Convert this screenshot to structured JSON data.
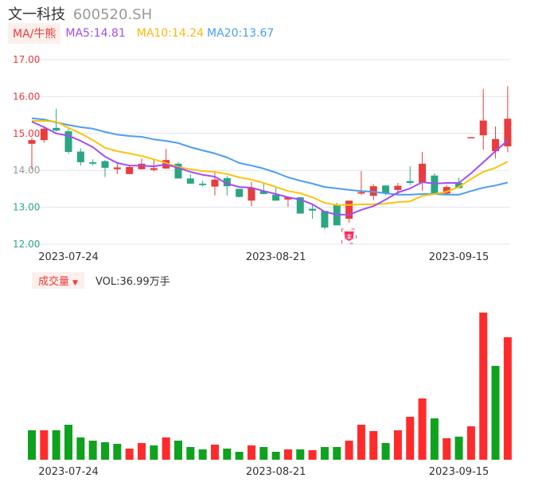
{
  "header": {
    "name": "文一科技",
    "code": "600520.SH"
  },
  "legend": {
    "tag": "MA/牛熊",
    "ma5": "MA5:14.81",
    "ma10": "MA10:14.24",
    "ma20": "MA20:13.67"
  },
  "volume_legend": {
    "tag": "成交量",
    "arrow": "▼",
    "value": "VOL:36.99万手"
  },
  "colors": {
    "up": "#ea3c3c",
    "down": "#2aa683",
    "vol_up": "#ff2b2b",
    "vol_down": "#0fa21e",
    "ma5": "#a34cf5",
    "ma10": "#fdc30d",
    "ma20": "#4b9ef0",
    "grid": "#e1e5f0"
  },
  "chart_data": [
    {
      "type": "candlestick",
      "title": "文一科技 600520.SH",
      "ylim": [
        12,
        17
      ],
      "y_ticks": [
        {
          "label": "17.00",
          "value": 17,
          "color": "#f0393c"
        },
        {
          "label": "16.00",
          "value": 16,
          "color": "#f0393c"
        },
        {
          "label": "15.00",
          "value": 15,
          "color": "#f0393c"
        },
        {
          "label": "14.00",
          "value": 14,
          "color": "#999999"
        },
        {
          "label": "13.00",
          "value": 13,
          "color": "#2aa683"
        },
        {
          "label": "12.00",
          "value": 12,
          "color": "#2aa683"
        }
      ],
      "x_ticks": [
        {
          "label": "2023-07-24",
          "index": 3
        },
        {
          "label": "2023-08-21",
          "index": 20
        },
        {
          "label": "2023-09-15",
          "index": 35
        }
      ],
      "ohlc": [
        [
          14.72,
          14.88,
          14.03,
          14.82
        ],
        [
          14.82,
          15.2,
          14.75,
          15.13
        ],
        [
          15.15,
          15.67,
          15.05,
          15.08
        ],
        [
          15.06,
          15.13,
          14.45,
          14.5
        ],
        [
          14.51,
          14.6,
          14.13,
          14.22
        ],
        [
          14.22,
          14.3,
          14.13,
          14.18
        ],
        [
          14.25,
          14.28,
          13.82,
          14.07
        ],
        [
          14.03,
          14.2,
          13.9,
          14.08
        ],
        [
          13.9,
          14.12,
          13.9,
          14.09
        ],
        [
          14.03,
          14.32,
          14.03,
          14.18
        ],
        [
          14.01,
          14.28,
          13.97,
          14.06
        ],
        [
          14.05,
          14.58,
          14.05,
          14.28
        ],
        [
          14.18,
          14.22,
          13.78,
          13.78
        ],
        [
          13.78,
          13.9,
          13.64,
          13.64
        ],
        [
          13.64,
          13.72,
          13.56,
          13.6
        ],
        [
          13.56,
          13.98,
          13.32,
          13.75
        ],
        [
          13.79,
          13.85,
          13.32,
          13.57
        ],
        [
          13.5,
          13.5,
          13.27,
          13.28
        ],
        [
          13.18,
          13.68,
          13.03,
          13.52
        ],
        [
          13.44,
          13.68,
          13.35,
          13.36
        ],
        [
          13.34,
          13.55,
          13.18,
          13.18
        ],
        [
          13.21,
          13.3,
          13.01,
          13.28
        ],
        [
          13.27,
          13.27,
          12.83,
          12.83
        ],
        [
          12.96,
          13.1,
          12.69,
          12.91
        ],
        [
          12.9,
          12.9,
          12.4,
          12.45
        ],
        [
          13.07,
          13.12,
          12.51,
          12.51
        ],
        [
          12.69,
          13.18,
          12.58,
          13.18
        ],
        [
          13.37,
          13.98,
          13.34,
          13.41
        ],
        [
          13.31,
          13.63,
          13.19,
          13.57
        ],
        [
          13.59,
          13.59,
          13.32,
          13.37
        ],
        [
          13.47,
          13.66,
          13.32,
          13.58
        ],
        [
          13.71,
          14.11,
          13.6,
          13.66
        ],
        [
          13.67,
          14.5,
          13.45,
          14.18
        ],
        [
          13.86,
          13.92,
          13.37,
          13.37
        ],
        [
          13.37,
          13.6,
          13.33,
          13.55
        ],
        [
          13.66,
          13.8,
          13.52,
          13.52
        ],
        [
          14.88,
          14.9,
          14.88,
          14.9
        ],
        [
          14.95,
          16.21,
          14.56,
          15.35
        ],
        [
          14.52,
          15.19,
          14.32,
          14.85
        ],
        [
          14.65,
          16.28,
          14.49,
          15.4
        ]
      ],
      "ma5": [
        15.32,
        15.17,
        15.0,
        14.94,
        14.8,
        14.63,
        14.37,
        14.2,
        14.13,
        14.13,
        14.11,
        14.16,
        14.07,
        13.96,
        13.88,
        13.83,
        13.64,
        13.55,
        13.53,
        13.44,
        13.36,
        13.27,
        13.21,
        13.08,
        12.88,
        12.8,
        12.8,
        12.93,
        13.03,
        13.21,
        13.4,
        13.51,
        13.68,
        13.64,
        13.66,
        13.66,
        13.92,
        14.22,
        14.52,
        14.81
      ],
      "ma10": [
        15.34,
        15.34,
        15.32,
        15.15,
        15.0,
        14.82,
        14.61,
        14.52,
        14.46,
        14.39,
        14.3,
        14.2,
        14.09,
        14.03,
        13.98,
        13.96,
        13.9,
        13.81,
        13.75,
        13.66,
        13.55,
        13.44,
        13.38,
        13.27,
        13.12,
        13.06,
        13.06,
        13.08,
        13.08,
        13.1,
        13.14,
        13.16,
        13.31,
        13.36,
        13.42,
        13.55,
        13.77,
        13.96,
        14.07,
        14.24
      ],
      "ma20": [
        15.41,
        15.38,
        15.3,
        15.23,
        15.17,
        15.13,
        15.04,
        14.97,
        14.93,
        14.91,
        14.84,
        14.8,
        14.74,
        14.63,
        14.54,
        14.46,
        14.35,
        14.2,
        14.13,
        14.05,
        13.94,
        13.81,
        13.72,
        13.64,
        13.55,
        13.51,
        13.47,
        13.44,
        13.42,
        13.38,
        13.34,
        13.34,
        13.36,
        13.36,
        13.34,
        13.34,
        13.44,
        13.53,
        13.59,
        13.67
      ],
      "marker": {
        "index": 26,
        "icon": "bull-icon"
      }
    },
    {
      "type": "bar",
      "title": "成交量",
      "unit": "万手",
      "x_ticks": [
        {
          "label": "2023-07-24",
          "index": 3
        },
        {
          "label": "2023-08-21",
          "index": 20
        },
        {
          "label": "2023-09-15",
          "index": 35
        }
      ],
      "values": [
        8.89,
        8.89,
        8.89,
        10.57,
        6.73,
        5.76,
        5.28,
        4.8,
        3.36,
        5.04,
        4.32,
        6.73,
        5.76,
        3.84,
        3.12,
        4.56,
        3.36,
        2.4,
        4.32,
        3.84,
        2.4,
        3.12,
        3.12,
        2.88,
        3.84,
        3.84,
        5.76,
        10.57,
        8.65,
        5.04,
        8.89,
        12.97,
        18.5,
        12.49,
        6.49,
        6.97,
        10.09,
        44.44,
        28.34,
        36.99
      ],
      "up": [
        0,
        1,
        0,
        0,
        0,
        0,
        0,
        0,
        1,
        1,
        0,
        1,
        0,
        0,
        0,
        1,
        0,
        0,
        1,
        0,
        0,
        1,
        0,
        1,
        0,
        0,
        1,
        1,
        1,
        0,
        1,
        1,
        1,
        0,
        1,
        0,
        1,
        1,
        0,
        1
      ]
    }
  ]
}
